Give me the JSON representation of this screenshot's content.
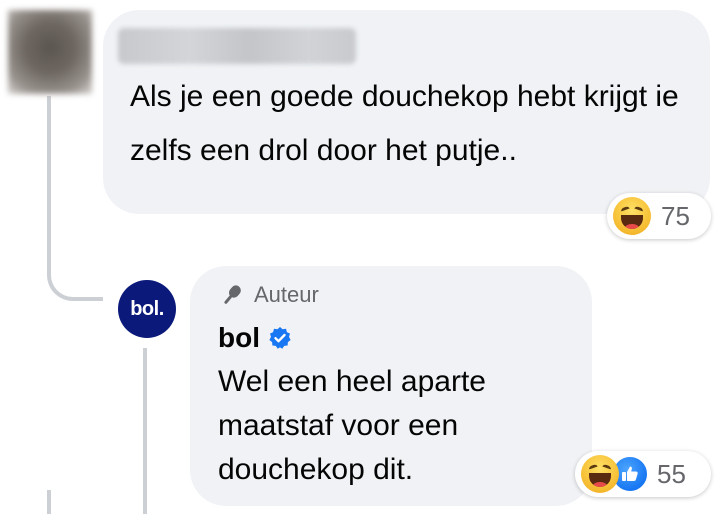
{
  "comment": {
    "text": "Als je een goede douchekop hebt krijgt ie zelfs een drol door het putje..",
    "reactions": {
      "icons": [
        "haha-emoji-icon"
      ],
      "count": "75"
    }
  },
  "reply": {
    "author_badge": "Auteur",
    "author_name": "bol",
    "avatar_label": "bol.",
    "text": "Wel een heel aparte maatstaf voor een douchekop dit.",
    "reactions": {
      "icons": [
        "haha-emoji-icon",
        "like-icon"
      ],
      "count": "55"
    }
  },
  "colors": {
    "bubble": "#f0f2f5",
    "bol_brand": "#0b1a7a",
    "verified": "#1877f2",
    "secondary_text": "#65676b"
  }
}
